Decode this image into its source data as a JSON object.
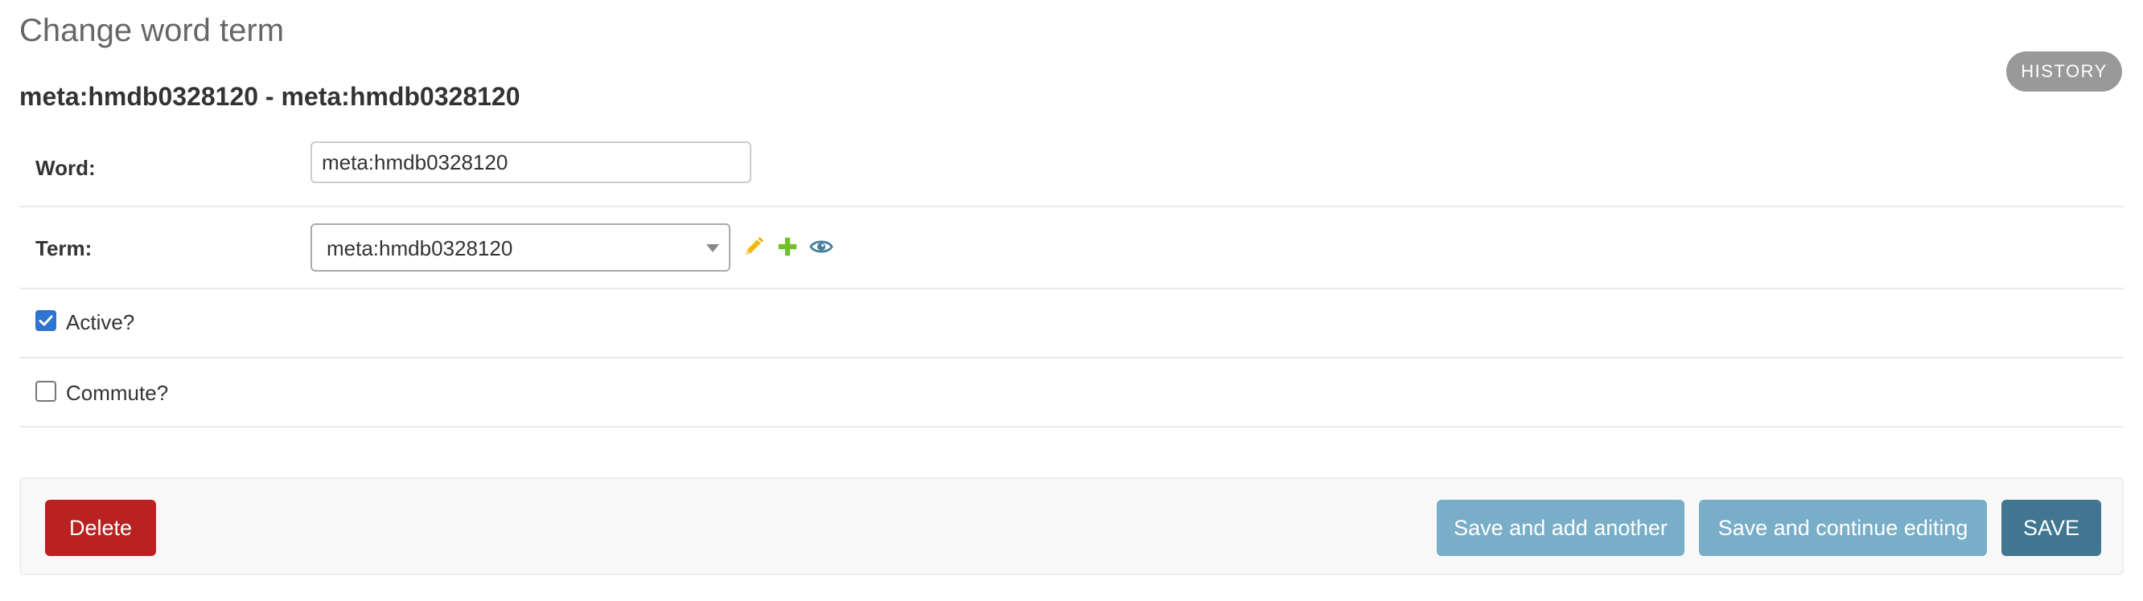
{
  "page": {
    "title": "Change word term",
    "object_title": "meta:hmdb0328120 - meta:hmdb0328120",
    "history_label": "HISTORY"
  },
  "form": {
    "word": {
      "label": "Word:",
      "value": "meta:hmdb0328120"
    },
    "term": {
      "label": "Term:",
      "selected": "meta:hmdb0328120",
      "icons": [
        "pencil-icon",
        "plus-icon",
        "eye-icon"
      ]
    },
    "active": {
      "label": "Active?",
      "checked": true
    },
    "commute": {
      "label": "Commute?",
      "checked": false
    }
  },
  "submit_row": {
    "delete_label": "Delete",
    "save_add_another_label": "Save and add another",
    "save_continue_label": "Save and continue editing",
    "save_label": "SAVE"
  },
  "colors": {
    "delete": "#ba2121",
    "secondary_button": "#79aec8",
    "primary_button": "#417690",
    "edit_icon": "#efb80b",
    "add_icon": "#70bf2b",
    "view_icon": "#447e9b",
    "checkbox_checked": "#2f74d0"
  }
}
